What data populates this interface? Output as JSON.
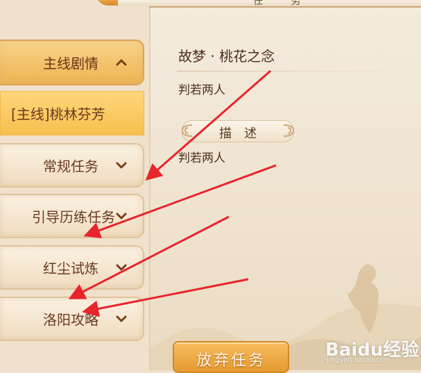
{
  "header": {
    "title_fragment": "任 务"
  },
  "sidebar": {
    "items": [
      {
        "label": "主线剧情",
        "icon": "chevron-up-icon",
        "state": "expanded"
      },
      {
        "label": "[主线]桃林芬芳",
        "state": "selected"
      },
      {
        "label": "常规任务",
        "icon": "chevron-down-icon"
      },
      {
        "label": "引导历练任务",
        "icon": "chevron-down-icon"
      },
      {
        "label": "红尘试炼",
        "icon": "chevron-down-icon"
      },
      {
        "label": "洛阳攻略",
        "icon": "chevron-down-icon"
      }
    ]
  },
  "task": {
    "title": "故梦 · 桃花之念",
    "goal": "判若两人",
    "description_header": "描述",
    "description": "判若两人",
    "abandon_label": "放弃任务"
  },
  "watermark": {
    "logo": "Baidu经验",
    "sub": "jingyan.baidu.com"
  },
  "colors": {
    "accent_gold": "#eeb352",
    "arrow_red": "#e8242c",
    "text_brown": "#4c2f1e"
  }
}
